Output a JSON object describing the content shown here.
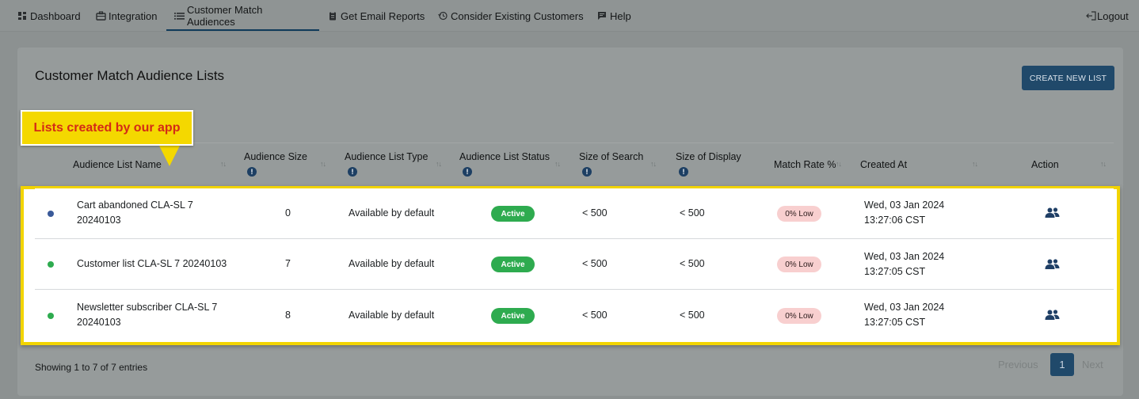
{
  "nav": {
    "items": [
      {
        "label": "Dashboard",
        "icon": "dashboard-icon"
      },
      {
        "label": "Integration",
        "icon": "briefcase-icon"
      },
      {
        "label": "Customer Match Audiences",
        "icon": "list-icon"
      },
      {
        "label": "Get Email Reports",
        "icon": "clipboard-icon"
      },
      {
        "label": "Consider Existing Customers",
        "icon": "history-icon"
      },
      {
        "label": "Help",
        "icon": "chat-icon"
      }
    ],
    "logout": "Logout"
  },
  "page": {
    "title": "Customer Match Audience Lists",
    "create_button": "CREATE NEW LIST"
  },
  "callout": "Lists created by our app",
  "table": {
    "columns": [
      "Audience List Name",
      "Audience Size",
      "Audience List Type",
      "Audience List Status",
      "Size of Search",
      "Size of Display",
      "Match Rate %",
      "Created At",
      "Action"
    ],
    "rows": [
      {
        "dot_color": "#3a5a99",
        "name_line1": "Cart abandoned CLA-SL 7",
        "name_line2": "20240103",
        "size": "0",
        "type": "Available by default",
        "status": "Active",
        "search": "< 500",
        "display": "< 500",
        "match": "0% Low",
        "created_line1": "Wed, 03 Jan 2024",
        "created_line2": "13:27:06 CST"
      },
      {
        "dot_color": "#2eab4f",
        "name_line1": "Customer list CLA-SL 7 20240103",
        "name_line2": "",
        "size": "7",
        "type": "Available by default",
        "status": "Active",
        "search": "< 500",
        "display": "< 500",
        "match": "0% Low",
        "created_line1": "Wed, 03 Jan 2024",
        "created_line2": "13:27:05 CST"
      },
      {
        "dot_color": "#2eab4f",
        "name_line1": "Newsletter subscriber CLA-SL 7",
        "name_line2": "20240103",
        "size": "8",
        "type": "Available by default",
        "status": "Active",
        "search": "< 500",
        "display": "< 500",
        "match": "0% Low",
        "created_line1": "Wed, 03 Jan 2024",
        "created_line2": "13:27:05 CST"
      }
    ]
  },
  "footer": {
    "showing": "Showing 1 to 7 of 7 entries",
    "previous": "Previous",
    "page": "1",
    "next": "Next"
  }
}
